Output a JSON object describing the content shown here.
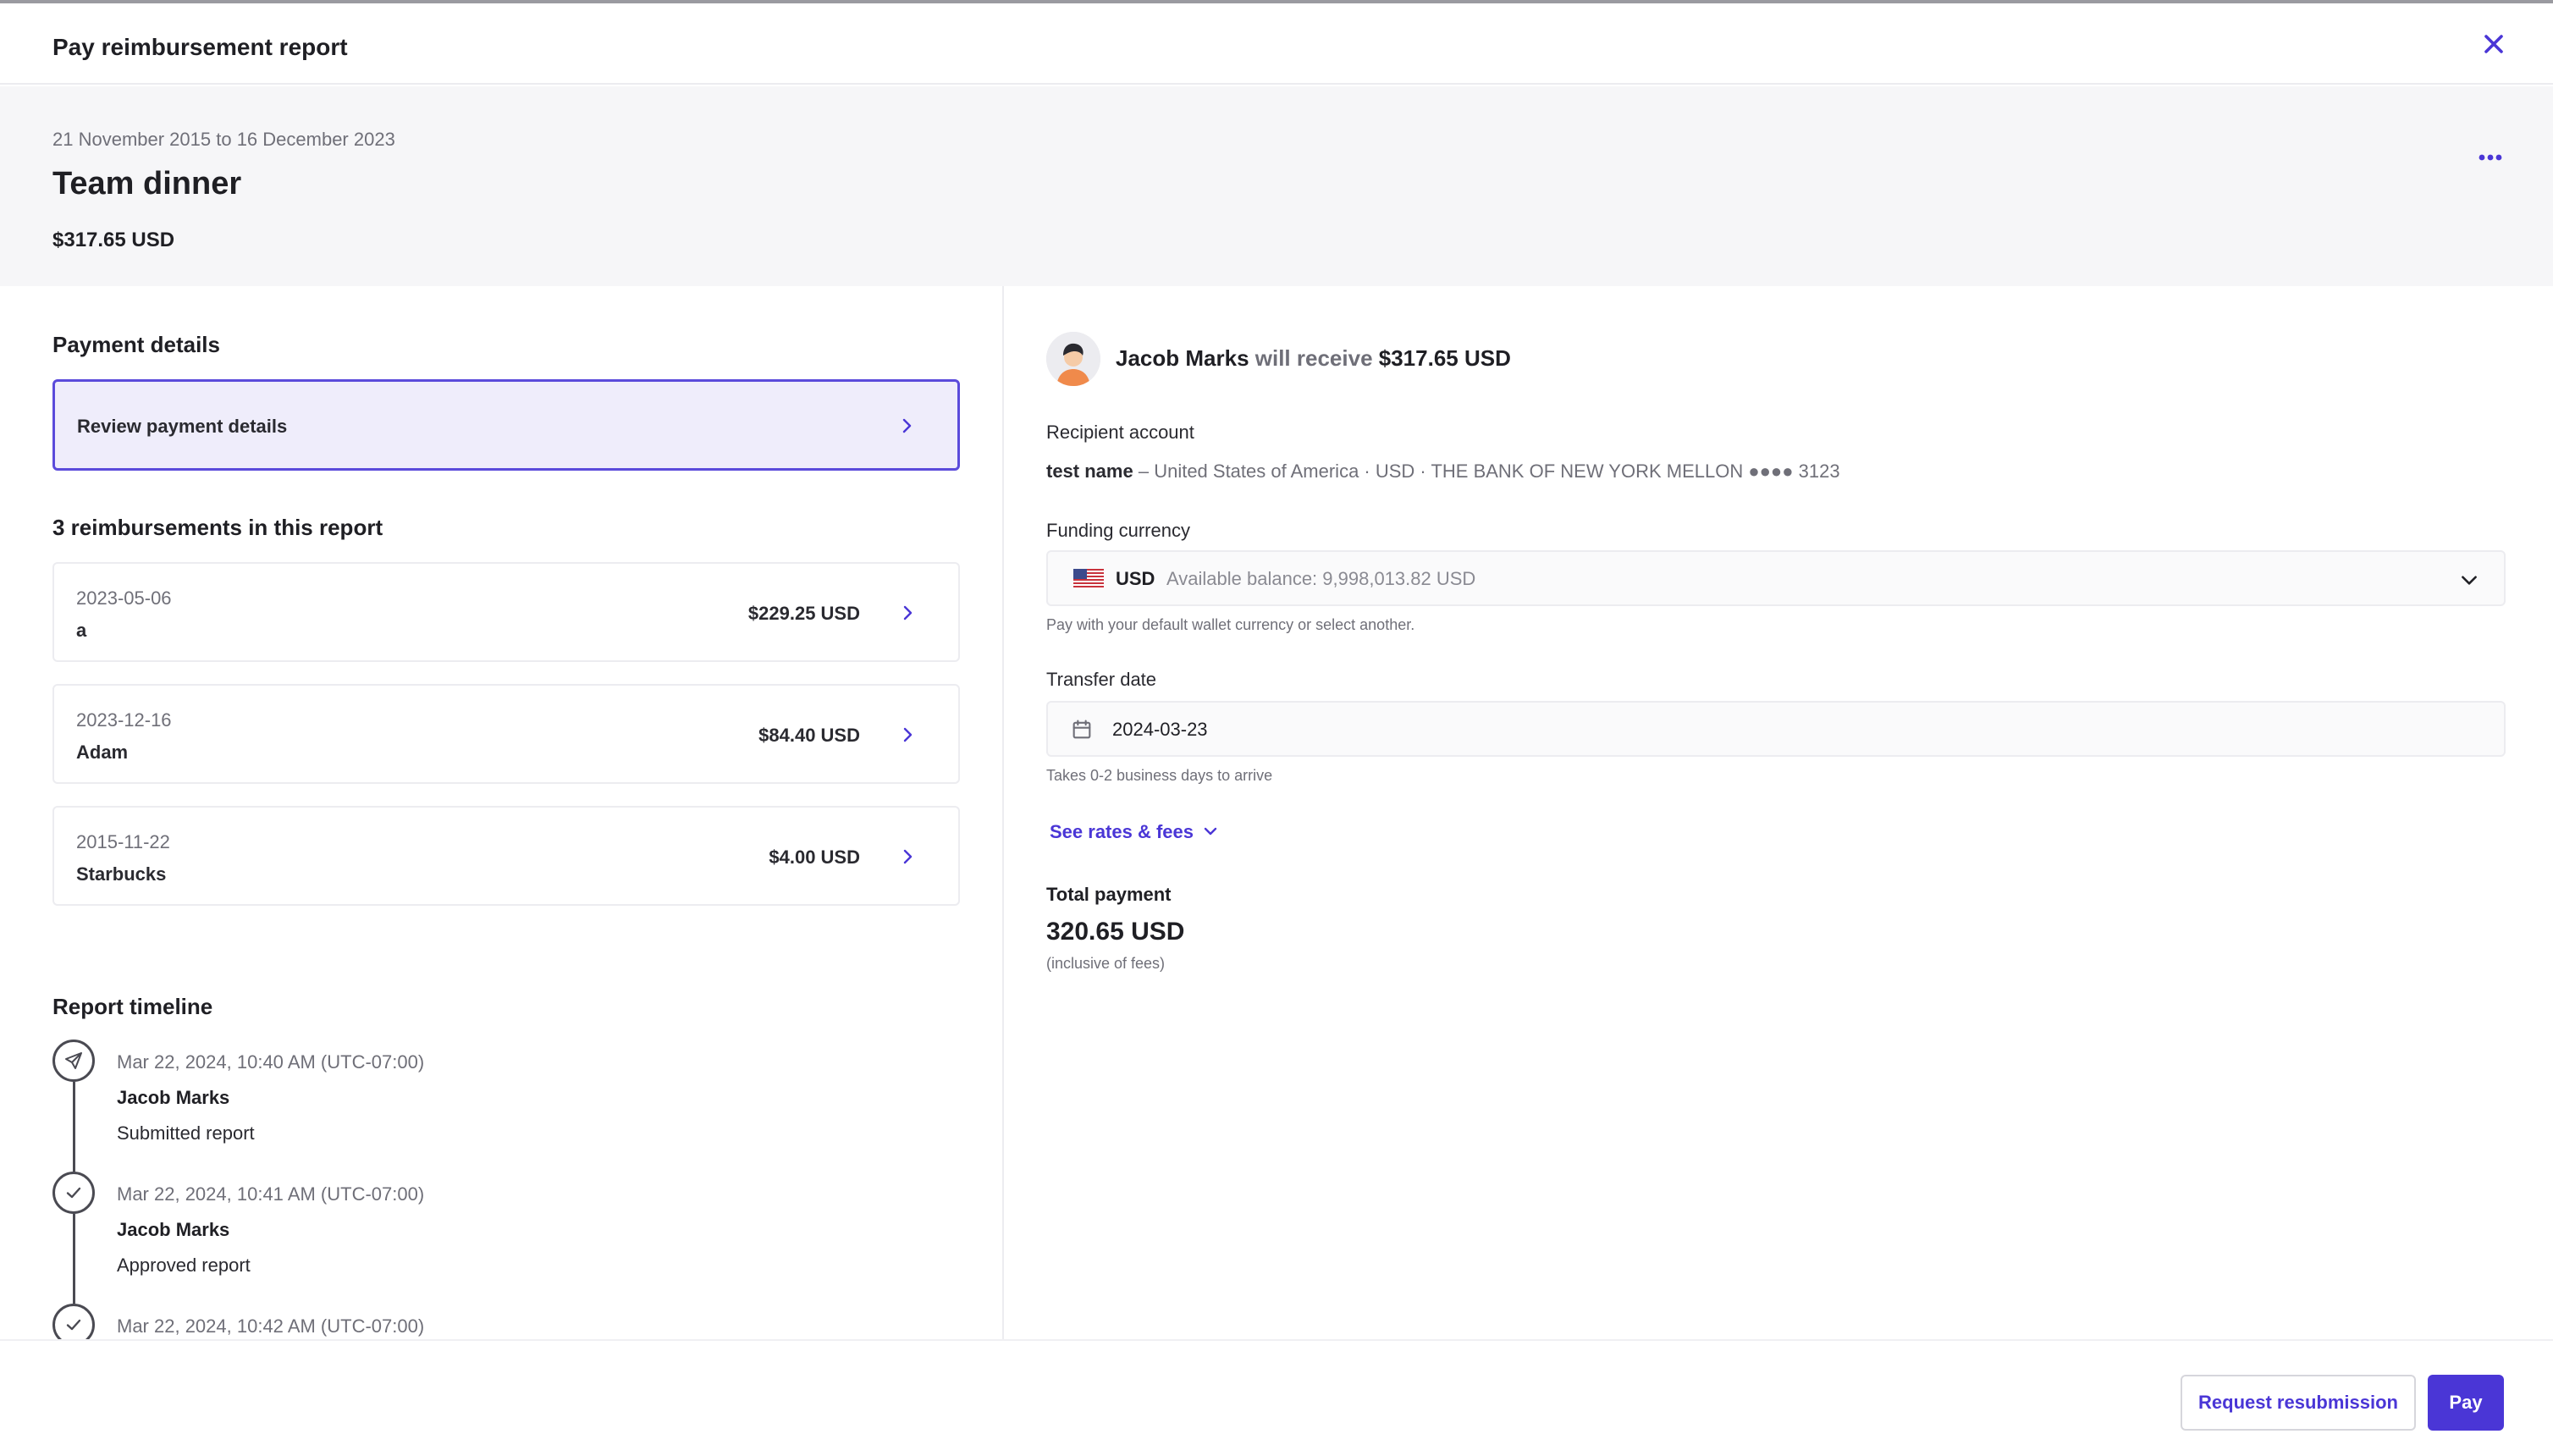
{
  "window": {
    "title": "Pay reimbursement report"
  },
  "report": {
    "date_range": "21 November 2015 to 16 December 2023",
    "title": "Team dinner",
    "amount": "$317.65 USD"
  },
  "payment_details": {
    "title": "Payment details",
    "review_label": "Review payment details"
  },
  "reimbursements": {
    "title": "3 reimbursements in this report",
    "items": [
      {
        "date": "2023-05-06",
        "name": "a",
        "amount": "$229.25 USD"
      },
      {
        "date": "2023-12-16",
        "name": "Adam",
        "amount": "$84.40 USD"
      },
      {
        "date": "2015-11-22",
        "name": "Starbucks",
        "amount": "$4.00 USD"
      }
    ]
  },
  "timeline": {
    "title": "Report timeline",
    "events": [
      {
        "time": "Mar 22, 2024, 10:40 AM (UTC-07:00)",
        "user": "Jacob Marks",
        "action": "Submitted report",
        "icon": "send-icon"
      },
      {
        "time": "Mar 22, 2024, 10:41 AM (UTC-07:00)",
        "user": "Jacob Marks",
        "action": "Approved report",
        "icon": "check-icon"
      },
      {
        "time": "Mar 22, 2024, 10:42 AM (UTC-07:00)",
        "user": "",
        "action": "",
        "icon": "check-icon"
      }
    ]
  },
  "recipient": {
    "name": "Jacob Marks",
    "verb": "will receive",
    "amount": "$317.65 USD",
    "account_label": "Recipient account",
    "account_name": "test name",
    "account_details": "– United States of America · USD · THE BANK OF NEW YORK MELLON ●●●● 3123"
  },
  "funding": {
    "label": "Funding currency",
    "currency": "USD",
    "balance": "Available balance: 9,998,013.82 USD",
    "hint": "Pay with your default wallet currency or select another."
  },
  "transfer": {
    "label": "Transfer date",
    "date": "2024-03-23",
    "hint": "Takes 0-2 business days to arrive"
  },
  "rates_link": "See rates & fees",
  "total": {
    "label": "Total payment",
    "value": "320.65 USD",
    "note": "(inclusive of fees)"
  },
  "footer": {
    "resubmit_label": "Request resubmission",
    "pay_label": "Pay"
  },
  "colors": {
    "accent": "#4a36d6",
    "review_bg": "#efedfb",
    "header_bg": "#f6f6f8"
  }
}
